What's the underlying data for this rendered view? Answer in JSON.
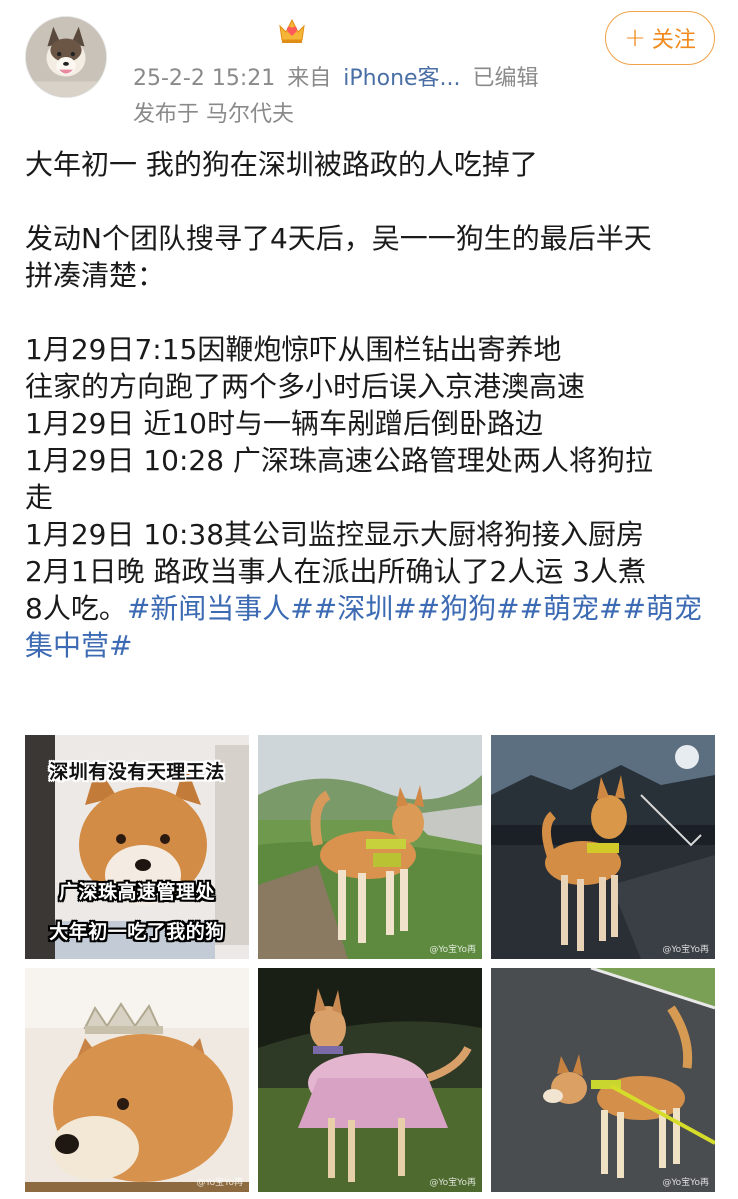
{
  "header": {
    "meta_date": "25-2-2 15:21",
    "meta_from": "来自",
    "meta_device": "iPhone客...",
    "meta_edited": "已编辑",
    "location": "发布于 马尔代夫",
    "follow_label": "关注"
  },
  "post": {
    "lines": [
      "大年初一 我的狗在深圳被路政的人吃掉了",
      "",
      "发动N个团队搜寻了4天后，吴一一狗生的最后半天",
      "拼凑清楚：",
      "",
      "1月29日7:15因鞭炮惊吓从围栏钻出寄养地",
      "往家的方向跑了两个多小时后误入京港澳高速",
      "1月29日 近10时与一辆车剐蹭后倒卧路边",
      "1月29日 10:28 广深珠高速公路管理处两人将狗拉",
      "走",
      "1月29日 10:38其公司监控显示大厨将狗接入厨房",
      "2月1日晚 路政当事人在派出所确认了2人运 3人煮"
    ],
    "last_line_prefix": "8人吃。",
    "hashtags_line1": "#新闻当事人##深圳##狗狗##萌宠##萌宠",
    "hashtags_line2": "集中营#"
  },
  "images": {
    "img1_top_caption": "深圳有没有天理王法",
    "img1_mid_caption": "广深珠高速管理处",
    "img1_bot_caption": "大年初一吃了我的狗",
    "watermark": "@Yo宝Yo再"
  },
  "colors": {
    "accent_orange": "#f08a1c",
    "link_blue": "#3d6bb3",
    "meta_gray": "#8a8a8a"
  }
}
